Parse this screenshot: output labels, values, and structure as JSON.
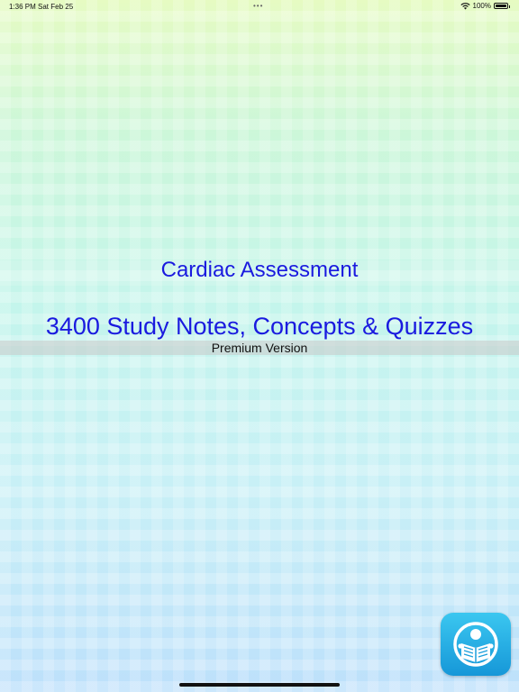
{
  "status_bar": {
    "time": "1:36 PM",
    "date": "Sat Feb 25",
    "dots": "•••",
    "battery_percent": "100%",
    "battery_level": 1.0,
    "icons": [
      "wifi-icon",
      "battery-icon"
    ]
  },
  "main": {
    "title": "Cardiac Assessment",
    "subtitle": "3400 Study Notes, Concepts & Quizzes",
    "version_label": "Premium Version"
  },
  "app_icon": {
    "icon": "reader-book-icon"
  },
  "colors": {
    "title_text": "#1a1adf",
    "icon_bg": "#1fa6e0"
  }
}
